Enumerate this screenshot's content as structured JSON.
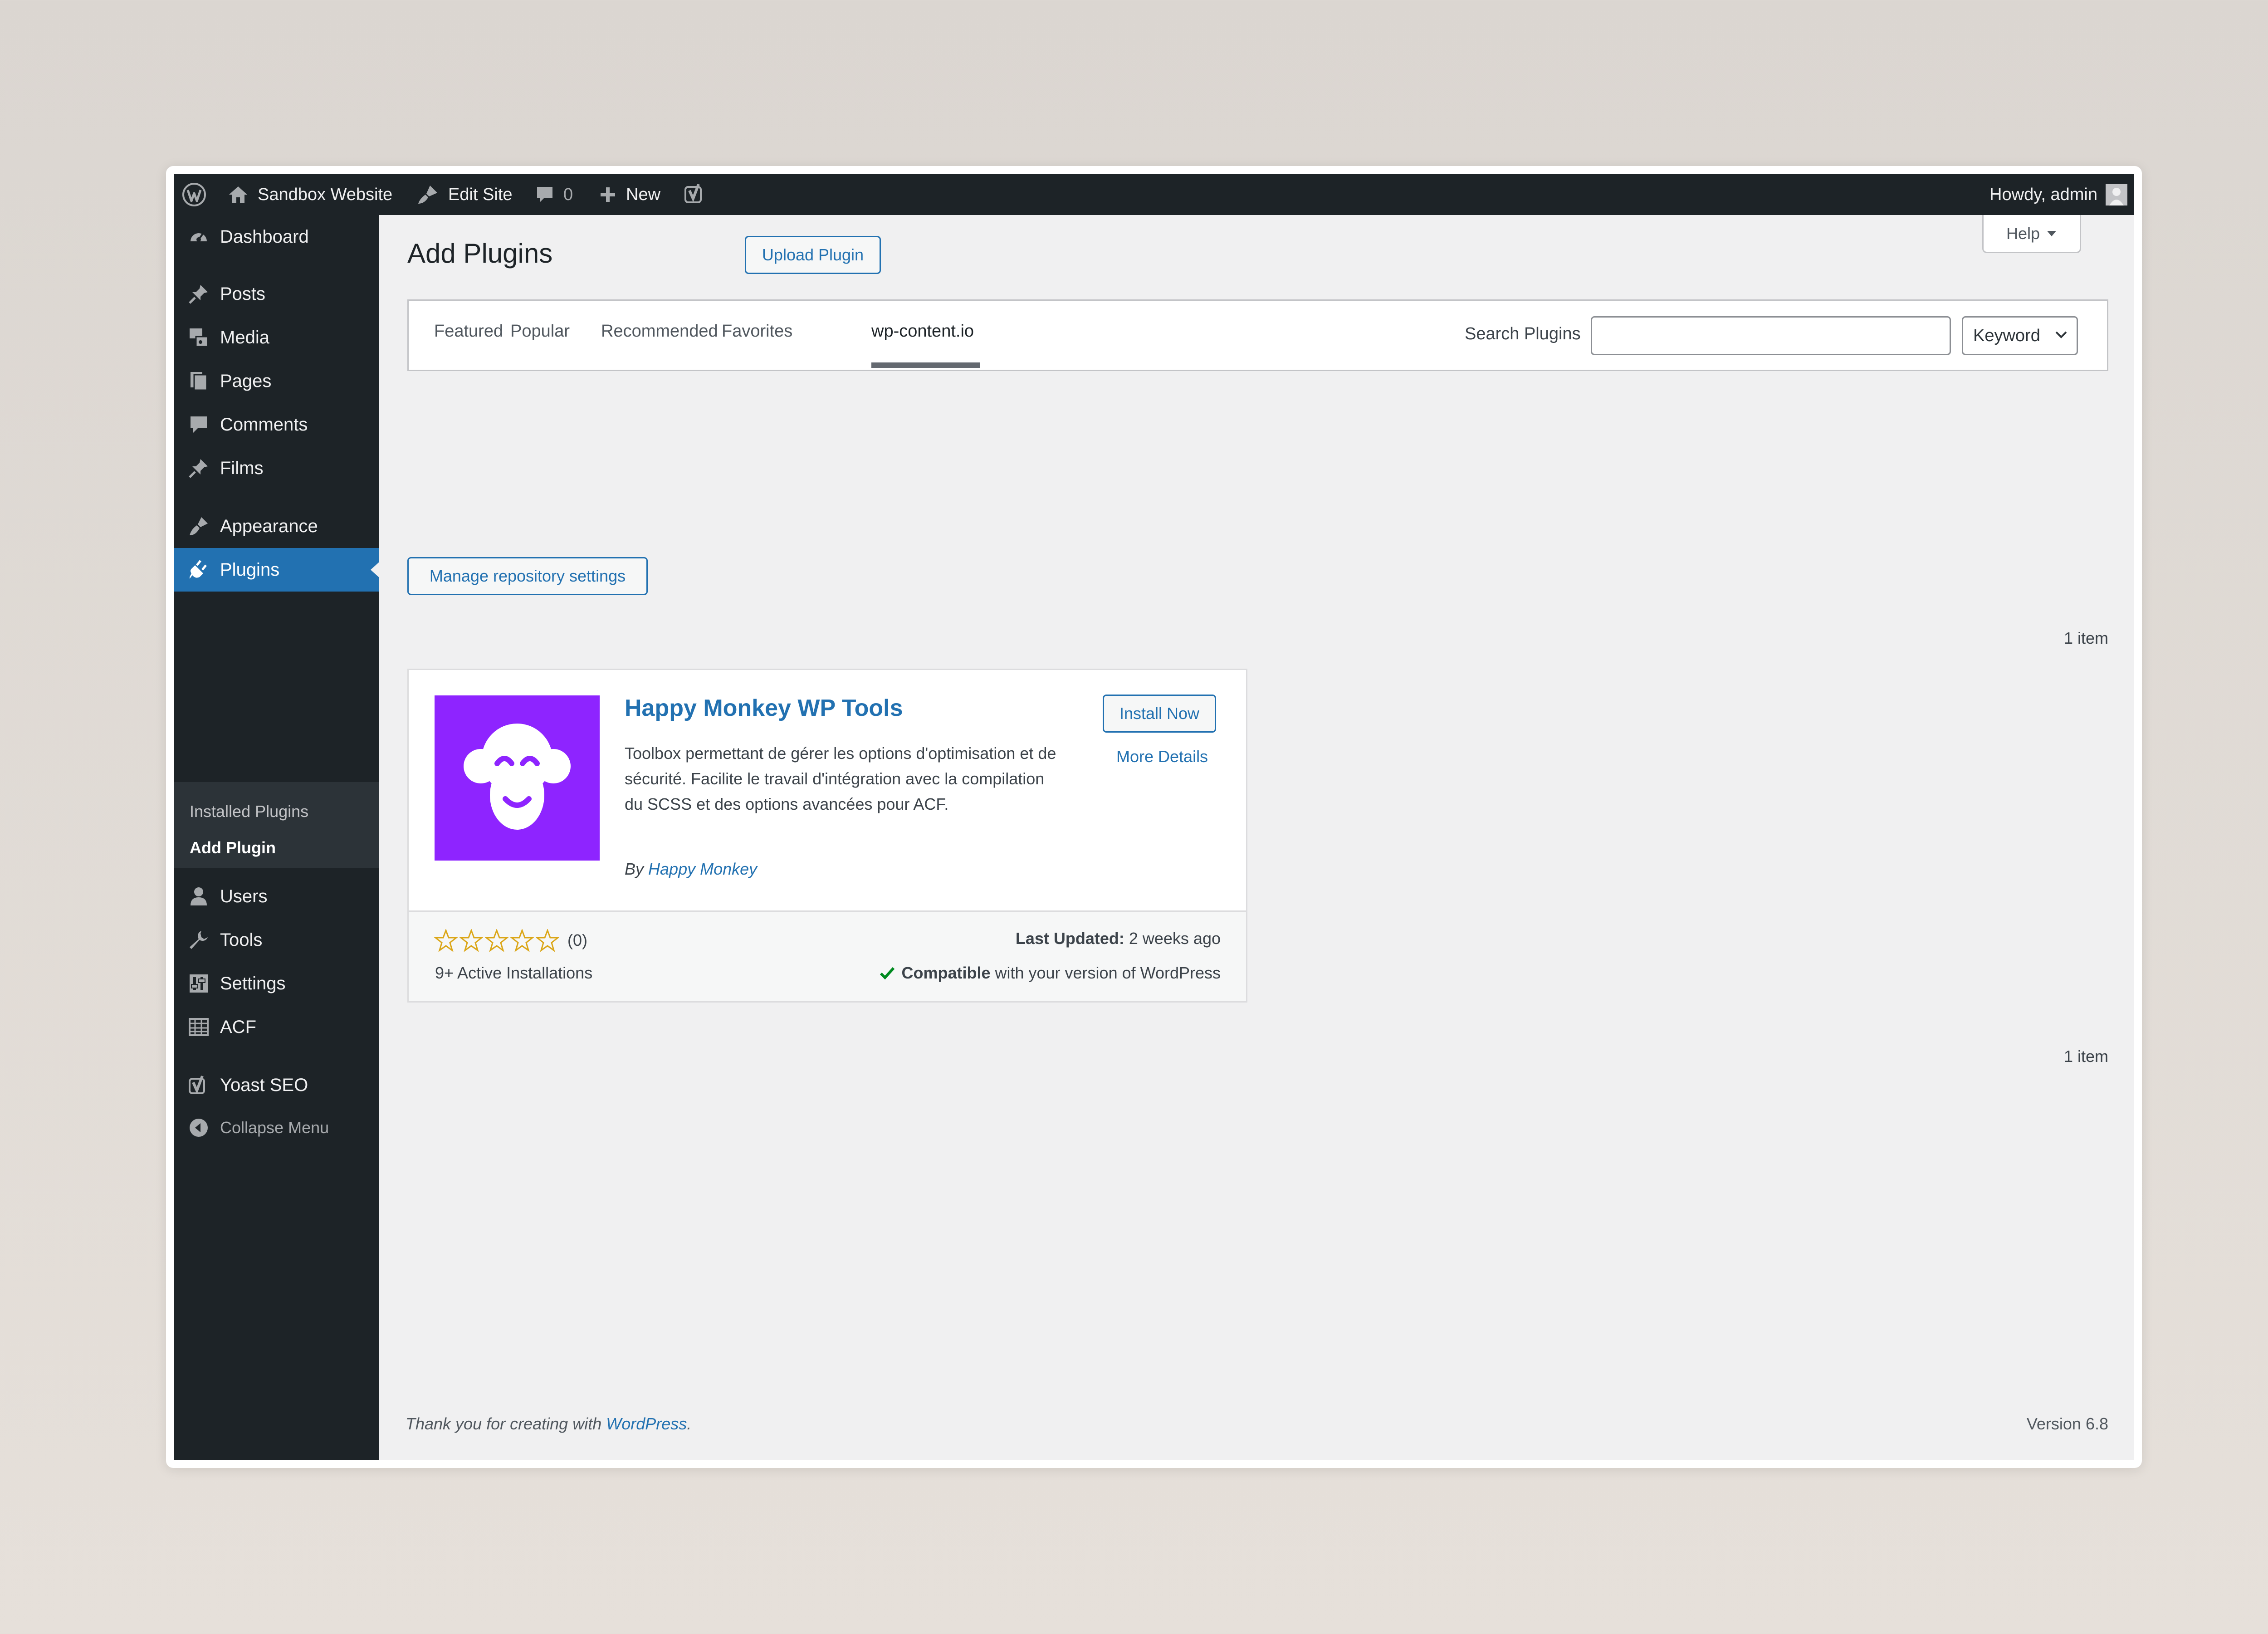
{
  "admin_bar": {
    "site_name": "Sandbox Website",
    "edit_site": "Edit Site",
    "comments_count": "0",
    "new": "New",
    "howdy": "Howdy, admin"
  },
  "sidebar": {
    "items": [
      {
        "label": "Dashboard",
        "icon": "dashboard-icon"
      },
      {
        "label": "Posts",
        "icon": "pin-icon"
      },
      {
        "label": "Media",
        "icon": "media-icon"
      },
      {
        "label": "Pages",
        "icon": "pages-icon"
      },
      {
        "label": "Comments",
        "icon": "comment-icon"
      },
      {
        "label": "Films",
        "icon": "pin-icon"
      },
      {
        "label": "Appearance",
        "icon": "brush-icon"
      },
      {
        "label": "Plugins",
        "icon": "plug-icon"
      },
      {
        "label": "Users",
        "icon": "user-icon"
      },
      {
        "label": "Tools",
        "icon": "wrench-icon"
      },
      {
        "label": "Settings",
        "icon": "sliders-icon"
      },
      {
        "label": "ACF",
        "icon": "table-icon"
      },
      {
        "label": "Yoast SEO",
        "icon": "yoast-icon"
      }
    ],
    "submenu": [
      "Installed Plugins",
      "Add Plugin"
    ],
    "collapse": "Collapse Menu"
  },
  "page": {
    "title": "Add Plugins",
    "upload_button": "Upload Plugin",
    "help": "Help",
    "tabs": [
      "Featured",
      "Popular",
      "Recommended",
      "Favorites",
      "wp-content.io"
    ],
    "current_tab": "wp-content.io",
    "search_label": "Search Plugins",
    "search_value": "",
    "search_type": "Keyword",
    "manage_repo_button": "Manage repository settings",
    "item_count": "1 item"
  },
  "plugin": {
    "name": "Happy Monkey WP Tools",
    "description": "Toolbox permettant de gérer les options d'optimisation et de sécurité. Facilite le travail d'intégration avec la compilation du SCSS et des options avancées pour ACF.",
    "by": "By",
    "author": "Happy Monkey",
    "install_button": "Install Now",
    "more_details": "More Details",
    "rating": 0,
    "rating_count": "(0)",
    "active_installs": "9+ Active Installations",
    "last_updated_label": "Last Updated:",
    "last_updated_value": "2 weeks ago",
    "compatible_label": "Compatible",
    "compatible_text": "with your version of WordPress",
    "icon_color": "#8e24ff"
  },
  "footer": {
    "thanks_prefix": "Thank you for creating with",
    "thanks_link": "WordPress",
    "thanks_suffix": ".",
    "version": "Version 6.8"
  },
  "colors": {
    "admin_dark": "#1d2327",
    "accent": "#2271b1",
    "background": "#f0f0f1",
    "star": "#dba617",
    "check": "#008a20"
  }
}
